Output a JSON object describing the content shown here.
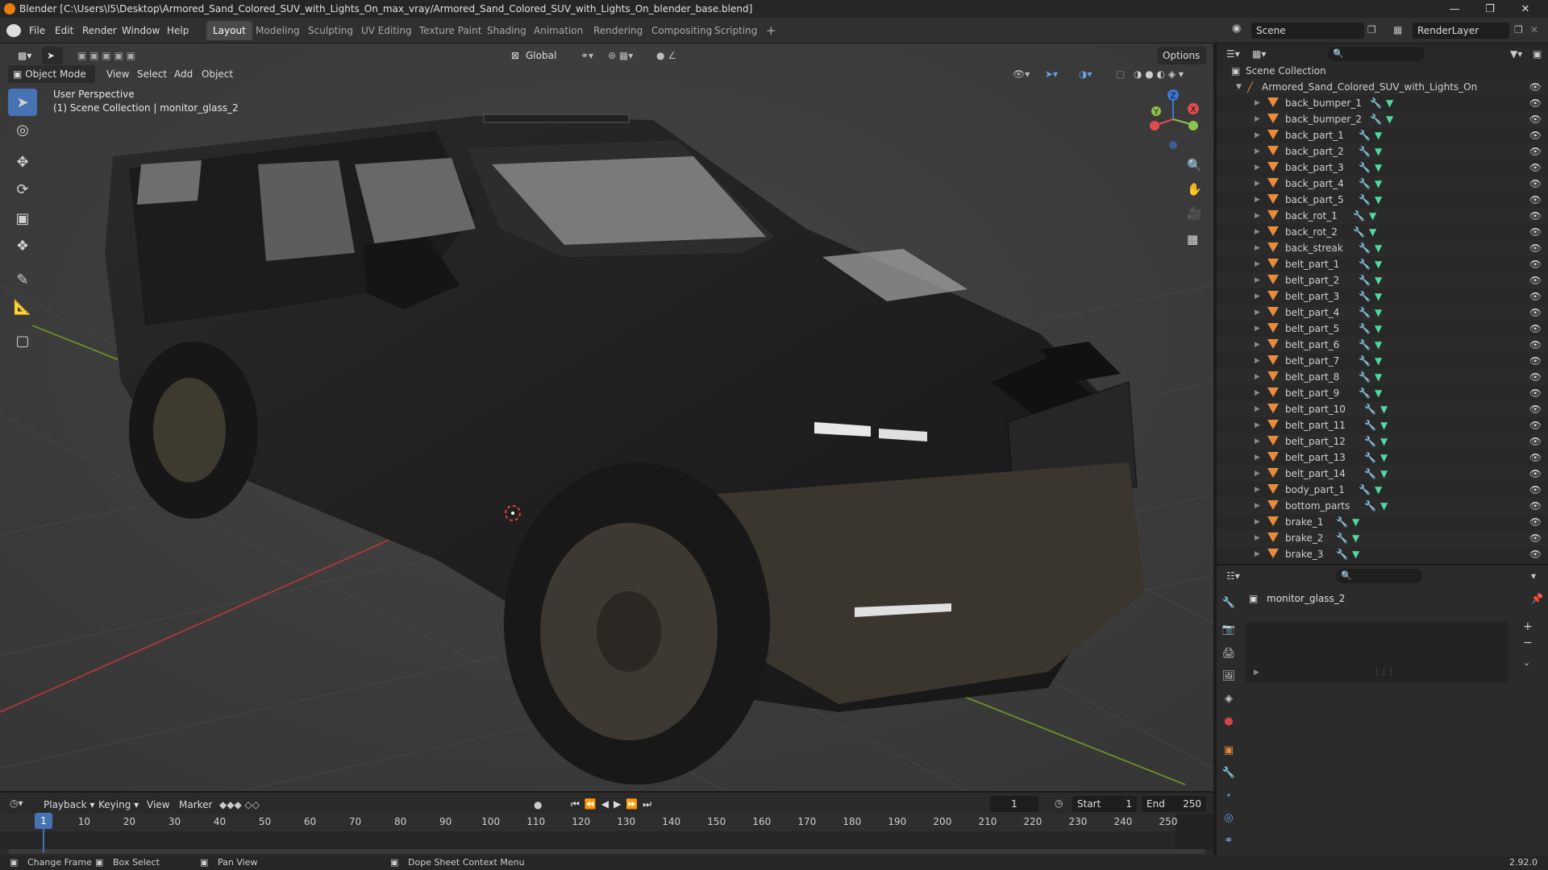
{
  "window": {
    "title": "Blender [C:\\Users\\l5\\Desktop\\Armored_Sand_Colored_SUV_with_Lights_On_max_vray/Armored_Sand_Colored_SUV_with_Lights_On_blender_base.blend]",
    "controls": [
      "minimize-icon",
      "maximize-icon",
      "close-icon"
    ]
  },
  "menu": [
    "File",
    "Edit",
    "Render",
    "Window",
    "Help"
  ],
  "workspaces": [
    "Layout",
    "Modeling",
    "Sculpting",
    "UV Editing",
    "Texture Paint",
    "Shading",
    "Animation",
    "Rendering",
    "Compositing",
    "Scripting"
  ],
  "active_workspace": "Layout",
  "scene": {
    "name": "Scene",
    "render_layer": "RenderLayer"
  },
  "viewport": {
    "mode": "Object Mode",
    "menus": [
      "View",
      "Select",
      "Add",
      "Object"
    ],
    "transform_orientation": "Global",
    "options_label": "Options",
    "perspective_label": "User Perspective",
    "collection_label": "(1) Scene Collection | monitor_glass_2",
    "gizmo": {
      "x": "X",
      "y": "Y",
      "z": "Z"
    }
  },
  "outliner": {
    "root": "Scene Collection",
    "collection": "Armored_Sand_Colored_SUV_with_Lights_On",
    "objects": [
      "back_bumper_1",
      "back_bumper_2",
      "back_part_1",
      "back_part_2",
      "back_part_3",
      "back_part_4",
      "back_part_5",
      "back_rot_1",
      "back_rot_2",
      "back_streak",
      "belt_part_1",
      "belt_part_2",
      "belt_part_3",
      "belt_part_4",
      "belt_part_5",
      "belt_part_6",
      "belt_part_7",
      "belt_part_8",
      "belt_part_9",
      "belt_part_10",
      "belt_part_11",
      "belt_part_12",
      "belt_part_13",
      "belt_part_14",
      "body_part_1",
      "bottom_parts",
      "brake_1",
      "brake_2",
      "brake_3"
    ]
  },
  "properties": {
    "object_name": "monitor_glass_2"
  },
  "timeline": {
    "menus": [
      "Playback",
      "Keying",
      "View",
      "Marker"
    ],
    "current_frame": "1",
    "start_label": "Start",
    "start": "1",
    "end_label": "End",
    "end": "250",
    "ticks": [
      "1",
      "10",
      "20",
      "30",
      "40",
      "50",
      "60",
      "70",
      "80",
      "90",
      "100",
      "110",
      "120",
      "130",
      "140",
      "150",
      "160",
      "170",
      "180",
      "190",
      "200",
      "210",
      "220",
      "230",
      "240",
      "250"
    ]
  },
  "statusbar": {
    "change_frame": "Change Frame",
    "box_select": "Box Select",
    "pan_view": "Pan View",
    "context_menu": "Dope Sheet Context Menu",
    "version": "2.92.0"
  }
}
